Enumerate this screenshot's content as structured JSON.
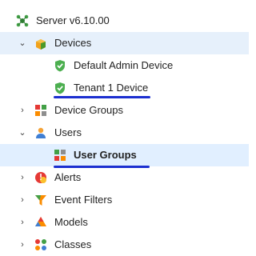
{
  "tree": {
    "server": {
      "label": "Server v6.10.00",
      "icon": "server-cluster-icon"
    },
    "devices": {
      "label": "Devices",
      "icon": "devices-folder-icon",
      "expanded": true
    },
    "default_admin_device": {
      "label": "Default Admin Device",
      "icon": "green-shield-check-icon"
    },
    "tenant_device": {
      "label": "Tenant 1 Device",
      "icon": "green-shield-check-icon"
    },
    "device_groups": {
      "label": "Device Groups",
      "icon": "device-groups-grid-icon",
      "expanded": false
    },
    "users": {
      "label": "Users",
      "icon": "users-icon",
      "expanded": true
    },
    "user_groups": {
      "label": "User Groups",
      "icon": "user-groups-grid-icon",
      "selected": true
    },
    "alerts": {
      "label": "Alerts",
      "icon": "alerts-icon",
      "expanded": false
    },
    "event_filters": {
      "label": "Event Filters",
      "icon": "funnel-icon",
      "expanded": false
    },
    "models": {
      "label": "Models",
      "icon": "models-icon",
      "expanded": false
    },
    "classes": {
      "label": "Classes",
      "icon": "classes-icon",
      "expanded": false
    }
  },
  "colors": {
    "accent_underline": "#1c2fd0",
    "selected_row": "#e1efff",
    "hover_row": "#e6f0fb",
    "check_green": "#4caf50"
  }
}
